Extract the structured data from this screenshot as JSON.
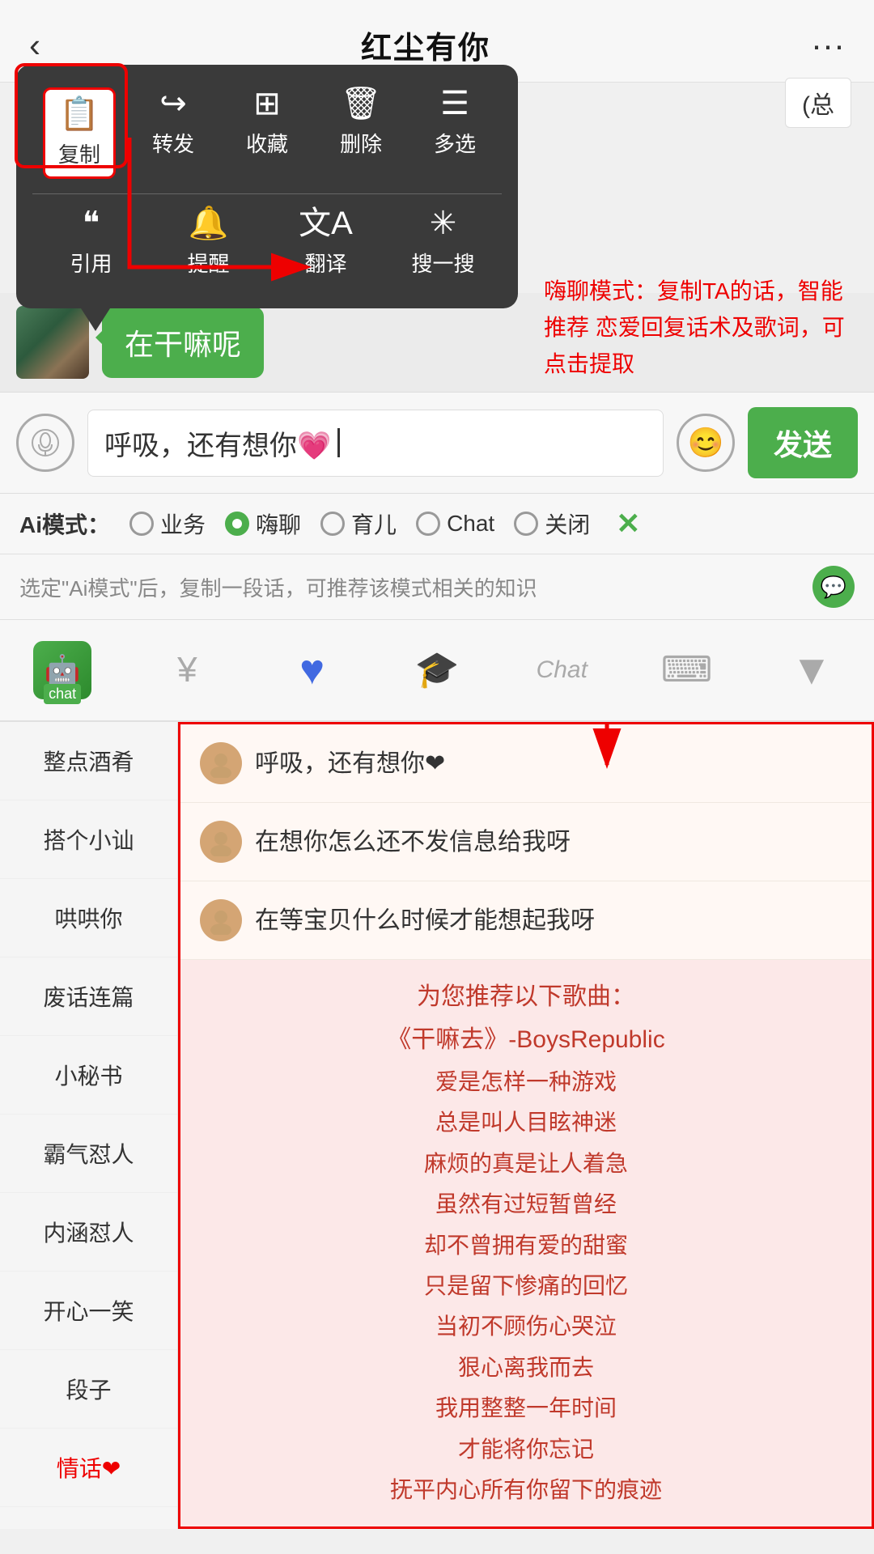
{
  "header": {
    "title": "红尘有你",
    "back_icon": "‹",
    "more_icon": "···"
  },
  "context_menu": {
    "row1": [
      {
        "icon": "📄",
        "label": "复制",
        "highlighted": true
      },
      {
        "icon": "↪",
        "label": "转发"
      },
      {
        "icon": "⊞",
        "label": "收藏"
      },
      {
        "icon": "🗑",
        "label": "删除"
      },
      {
        "icon": "☰",
        "label": "多选"
      }
    ],
    "row2": [
      {
        "icon": "❝",
        "label": "引用"
      },
      {
        "icon": "🔔",
        "label": "提醒"
      },
      {
        "icon": "文A",
        "label": "翻译"
      },
      {
        "icon": "⊁",
        "label": "搜一搜"
      }
    ]
  },
  "total_badge": "(总",
  "chat_message": "在干嘛呢",
  "annotation_top": "嗨聊模式：复制TA的话，智能推荐\n恋爱回复话术及歌词，可点击提取",
  "input": {
    "text": "呼吸，还有想你💗",
    "send_label": "发送"
  },
  "ai_modes": {
    "label": "Ai模式：",
    "options": [
      {
        "id": "business",
        "label": "业务",
        "active": false
      },
      {
        "id": "haijiao",
        "label": "嗨聊",
        "active": true
      },
      {
        "id": "yuer",
        "label": "育儿",
        "active": false
      },
      {
        "id": "chat",
        "label": "Chat",
        "active": false
      },
      {
        "id": "close",
        "label": "关闭",
        "active": false
      }
    ],
    "close_icon": "✕"
  },
  "hint_bar": {
    "text": "选定\"Ai模式\"后，复制一段话，可推荐该模式相关的知识"
  },
  "toolbar": {
    "items": [
      {
        "id": "robot",
        "label": "chat",
        "type": "robot"
      },
      {
        "id": "money",
        "icon": "¥",
        "type": "icon"
      },
      {
        "id": "heart",
        "icon": "♥",
        "type": "icon",
        "color": "#4169e1"
      },
      {
        "id": "graduation",
        "icon": "🎓",
        "type": "icon"
      },
      {
        "id": "chat_text",
        "label": "Chat",
        "type": "text"
      },
      {
        "id": "keyboard",
        "icon": "⌨",
        "type": "icon"
      },
      {
        "id": "dropdown",
        "icon": "▼",
        "type": "icon"
      }
    ]
  },
  "sidebar": {
    "items": [
      {
        "label": "整点酒肴"
      },
      {
        "label": "搭个小讪"
      },
      {
        "label": "哄哄你"
      },
      {
        "label": "废话连篇"
      },
      {
        "label": "小秘书"
      },
      {
        "label": "霸气怼人"
      },
      {
        "label": "内涵怼人"
      },
      {
        "label": "开心一笑"
      },
      {
        "label": "段子"
      },
      {
        "label": "情话❤"
      }
    ]
  },
  "suggestions": [
    {
      "text": "呼吸，还有想你❤"
    },
    {
      "text": "在想你怎么还不发信息给我呀"
    },
    {
      "text": "在等宝贝什么时候才能想起我呀"
    }
  ],
  "song_section": {
    "intro": "为您推荐以下歌曲：",
    "title": "《干嘛去》-BoysRepublic",
    "lyrics": [
      "爱是怎样一种游戏",
      "总是叫人目眩神迷",
      "麻烦的真是让人着急",
      "虽然有过短暂曾经",
      "却不曾拥有爱的甜蜜",
      "只是留下惨痛的回忆",
      "当初不顾伤心哭泣",
      "狠心离我而去",
      "我用整整一年时间",
      "才能将你忘记",
      "抚平内心所有你留下的痕迹"
    ]
  }
}
